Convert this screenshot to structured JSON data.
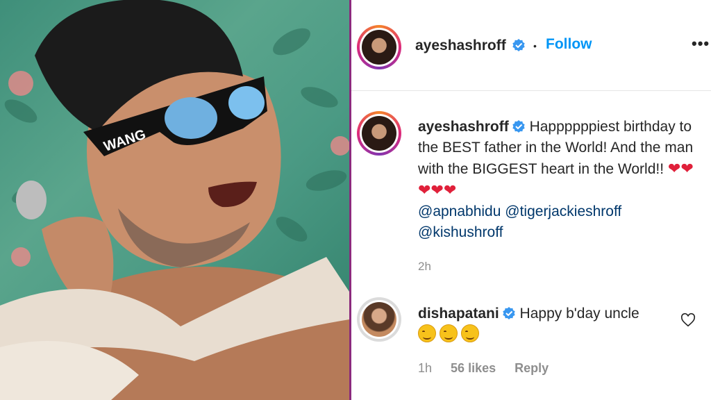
{
  "post_image": {
    "cap_text": "WANG"
  },
  "header": {
    "username": "ayeshashroff",
    "separator": "•",
    "follow_label": "Follow",
    "more_label": "•••"
  },
  "caption": {
    "username": "ayeshashroff",
    "text_1": "Happppppiest birthday to the BEST father in the World! And the man with the BIGGEST heart in the World!!",
    "hearts": "❤❤❤❤❤",
    "mentions": [
      "@apnabhidu",
      "@tigerjackieshroff",
      "@kishushroff"
    ],
    "time": "2h"
  },
  "comment": {
    "username": "dishapatani",
    "text": "Happy b'day uncle",
    "emoji_count": 3,
    "time": "1h",
    "likes": "56 likes",
    "reply_label": "Reply"
  },
  "colors": {
    "accent": "#0095f6",
    "divider": "#8b2a7d",
    "heart": "#e0203a"
  }
}
